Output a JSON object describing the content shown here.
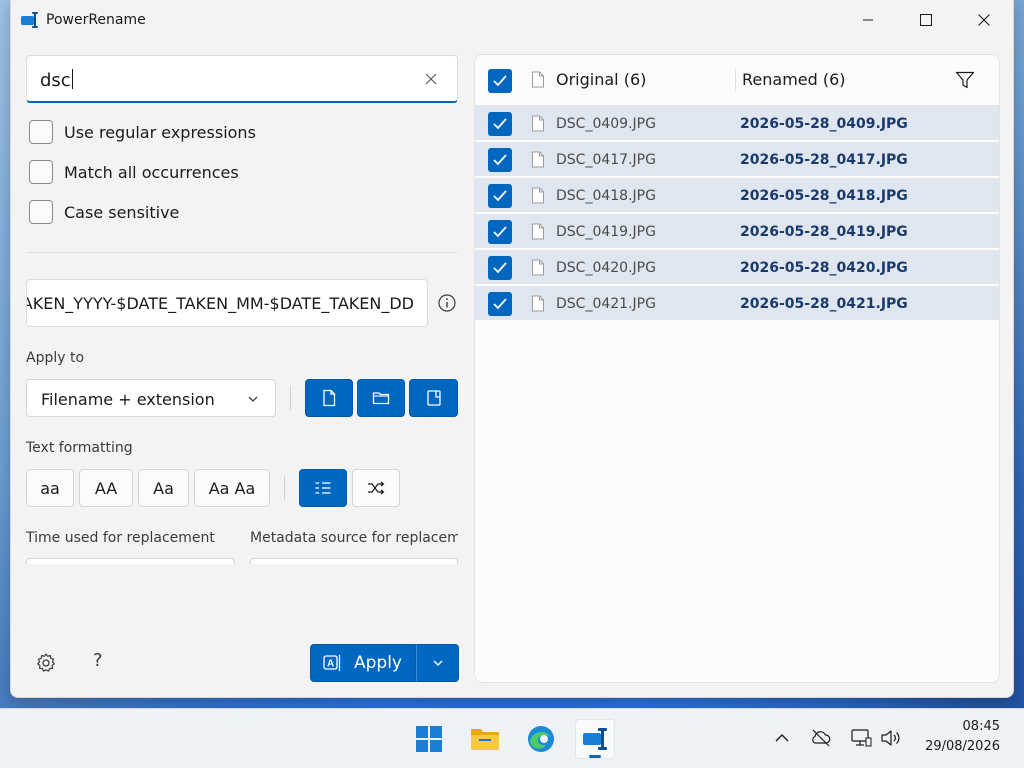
{
  "window": {
    "title": "PowerRename",
    "minimize_icon": "minimize-icon",
    "maximize_icon": "maximize-icon",
    "close_icon": "close-icon"
  },
  "search": {
    "value": "dsc"
  },
  "options": [
    {
      "label": "Use regular expressions",
      "checked": false
    },
    {
      "label": "Match all occurrences",
      "checked": false
    },
    {
      "label": "Case sensitive",
      "checked": false
    }
  ],
  "replace": {
    "value": "$DATE_TAKEN_YYYY-$DATE_TAKEN_MM-$DATE_TAKEN_DD"
  },
  "apply_to": {
    "label": "Apply to",
    "selected": "Filename + extension"
  },
  "text_formatting": {
    "label": "Text formatting",
    "buttons": [
      "aa",
      "AA",
      "Aa",
      "Aa Aa"
    ]
  },
  "time_used_label": "Time used for replacement",
  "metadata_source_label": "Metadata source for replacement",
  "apply_button": {
    "label": "Apply"
  },
  "list": {
    "original_header": "Original (6)",
    "renamed_header": "Renamed (6)",
    "rows": [
      {
        "original": "DSC_0409.JPG",
        "renamed": "2026-05-28_0409.JPG"
      },
      {
        "original": "DSC_0417.JPG",
        "renamed": "2026-05-28_0417.JPG"
      },
      {
        "original": "DSC_0418.JPG",
        "renamed": "2026-05-28_0418.JPG"
      },
      {
        "original": "DSC_0419.JPG",
        "renamed": "2026-05-28_0419.JPG"
      },
      {
        "original": "DSC_0420.JPG",
        "renamed": "2026-05-28_0420.JPG"
      },
      {
        "original": "DSC_0421.JPG",
        "renamed": "2026-05-28_0421.JPG"
      }
    ]
  },
  "taskbar": {
    "time": "08:45",
    "date": "29/08/2026"
  },
  "colors": {
    "accent": "#0067c0",
    "row_selected": "#e0e6f0",
    "renamed_text": "#1a3a6b"
  }
}
